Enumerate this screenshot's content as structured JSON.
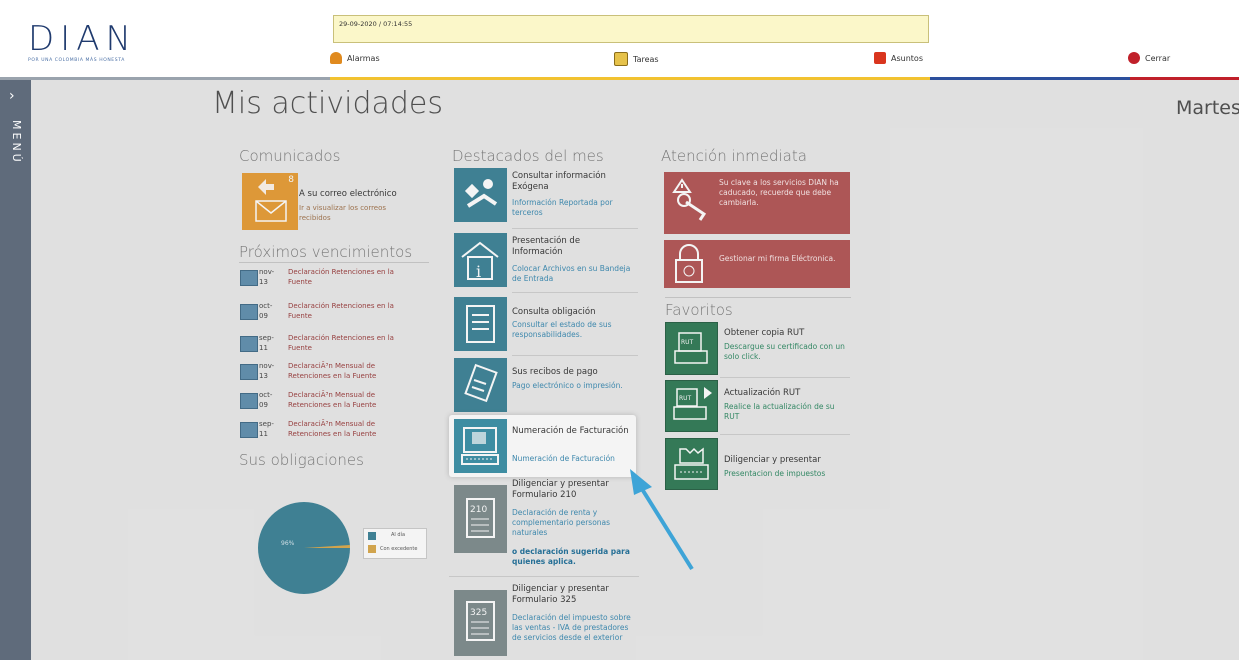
{
  "header": {
    "logo_word": "DIAN",
    "logo_tagline": "POR UNA COLOMBIA MÁS HONESTA",
    "datetime": "29-09-2020 / 07:14:55",
    "items": [
      {
        "label": "Alarmas",
        "icon": "bell-icon"
      },
      {
        "label": "Tareas",
        "icon": "tasks-icon"
      },
      {
        "label": "Asuntos",
        "icon": "folder-icon"
      },
      {
        "label": "Cerrar",
        "icon": "power-icon"
      }
    ]
  },
  "sidebar": {
    "chevron": "›",
    "menu_label": "MENÚ"
  },
  "page": {
    "title": "Mis actividades",
    "day": "Martes"
  },
  "comunicados": {
    "title": "Comunicados",
    "badge": "8",
    "tile_title": "A su correo electrónico",
    "tile_sub": "Ir a visualizar los correos recibidos"
  },
  "vencimientos": {
    "title": "Próximos vencimientos",
    "items": [
      {
        "date1": "nov-",
        "date2": "13",
        "line1": "Declaración Retenciones en la",
        "line2": "Fuente"
      },
      {
        "date1": "oct-",
        "date2": "09",
        "line1": "Declaración Retenciones en la",
        "line2": "Fuente"
      },
      {
        "date1": "sep-",
        "date2": "11",
        "line1": "Declaración Retenciones en la",
        "line2": "Fuente"
      },
      {
        "date1": "nov-",
        "date2": "13",
        "line1": "DeclaraciÃ³n Mensual de",
        "line2": "Retenciones en la Fuente"
      },
      {
        "date1": "oct-",
        "date2": "09",
        "line1": "DeclaraciÃ³n Mensual de",
        "line2": "Retenciones en la Fuente"
      },
      {
        "date1": "sep-",
        "date2": "11",
        "line1": "DeclaraciÃ³n Mensual de",
        "line2": "Retenciones en la Fuente"
      }
    ]
  },
  "obligaciones": {
    "title": "Sus obligaciones",
    "pie_label": "96%",
    "legend": [
      {
        "label": "Al día",
        "color": "#3b8296"
      },
      {
        "label": "Con excedente",
        "color": "#d9a94a"
      }
    ]
  },
  "destacados": {
    "title": "Destacados del mes",
    "items": [
      {
        "title": "Consultar información Exógena",
        "sub": "Información Reportada por terceros"
      },
      {
        "title": "Presentación de Información",
        "sub": "Colocar Archivos en su Bandeja de Entrada"
      },
      {
        "title": "Consulta obligación",
        "sub": "Consultar el estado de sus responsabilidades."
      },
      {
        "title": "Sus recibos de pago",
        "sub": "Pago electrónico o impresión."
      },
      {
        "title": "Numeración de Facturación",
        "sub": "Numeración de Facturación"
      },
      {
        "title": "Diligenciar y presentar Formulario 210",
        "sub": "Declaración de renta y complementario personas naturales",
        "bold": "o declaración sugerida para quienes aplica.",
        "icon_num": "210"
      },
      {
        "title": "Diligenciar y presentar Formulario 325",
        "sub": "Declaración del impuesto sobre las ventas - IVA de prestadores de servicios desde el exterior",
        "icon_num": "325"
      }
    ]
  },
  "atencion": {
    "title": "Atención inmediata",
    "items": [
      {
        "text": "Su clave a los servicios DIAN ha caducado, recuerde que debe cambiarla."
      },
      {
        "text": "Gestionar mi firma Eléctronica."
      }
    ]
  },
  "favoritos": {
    "title": "Favoritos",
    "items": [
      {
        "title": "Obtener copia RUT",
        "sub": "Descargue su certificado con un solo click.",
        "icon_label": "RUT"
      },
      {
        "title": "Actualización RUT",
        "sub": "Realice la actualización de su RUT",
        "icon_label": "RUT"
      },
      {
        "title": "Diligenciar y presentar",
        "sub": "Presentacion de impuestos"
      }
    ]
  },
  "colors": {
    "accent_blue": "#3b8296",
    "alert_red": "#b25454",
    "favorite_green": "#2f7a55",
    "arrow": "#3aa9e0",
    "comunicados_orange": "#e79c33"
  }
}
